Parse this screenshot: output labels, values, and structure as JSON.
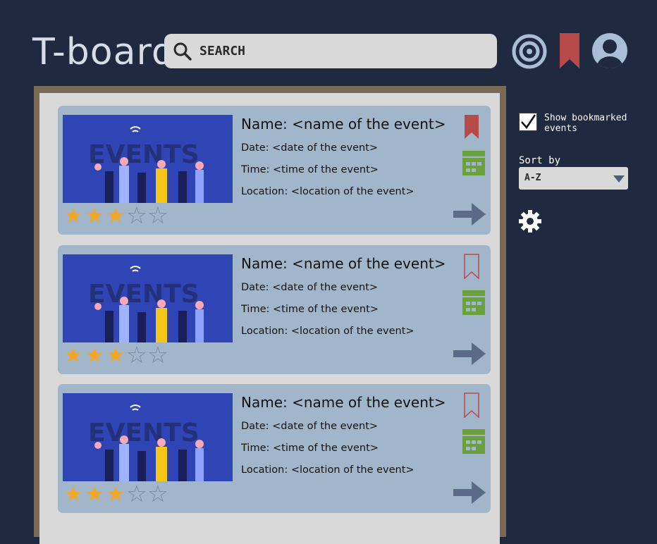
{
  "header": {
    "logo_text": "T-board",
    "search_placeholder": "SEARCH"
  },
  "events": [
    {
      "name": "Name: <name of the event>",
      "date": "Date: <date of the event>",
      "time": "Time: <time of the event>",
      "location": "Location: <location of the event>",
      "rating": 3,
      "max_rating": 5,
      "bookmarked": true,
      "image_letters": "EVENTS"
    },
    {
      "name": "Name: <name of the event>",
      "date": "Date: <date of the event>",
      "time": "Time: <time of the event>",
      "location": "Location: <location of the event>",
      "rating": 3,
      "max_rating": 5,
      "bookmarked": false,
      "image_letters": "EVENTS"
    },
    {
      "name": "Name: <name of the event>",
      "date": "Date: <date of the event>",
      "time": "Time: <time of the event>",
      "location": "Location: <location of the event>",
      "rating": 3,
      "max_rating": 5,
      "bookmarked": false,
      "image_letters": "EVENTS"
    }
  ],
  "sidebar": {
    "show_bookmarked_label": "Show bookmarked events",
    "show_bookmarked_checked": true,
    "sort_label": "Sort by",
    "sort_value": "A-Z"
  },
  "colors": {
    "background": "#1f2a40",
    "card": "#a2b6cb",
    "bookmark": "#b84a4a",
    "calendar": "#6aa13c",
    "arrow": "#5b6b87",
    "star": "#f5a623"
  }
}
